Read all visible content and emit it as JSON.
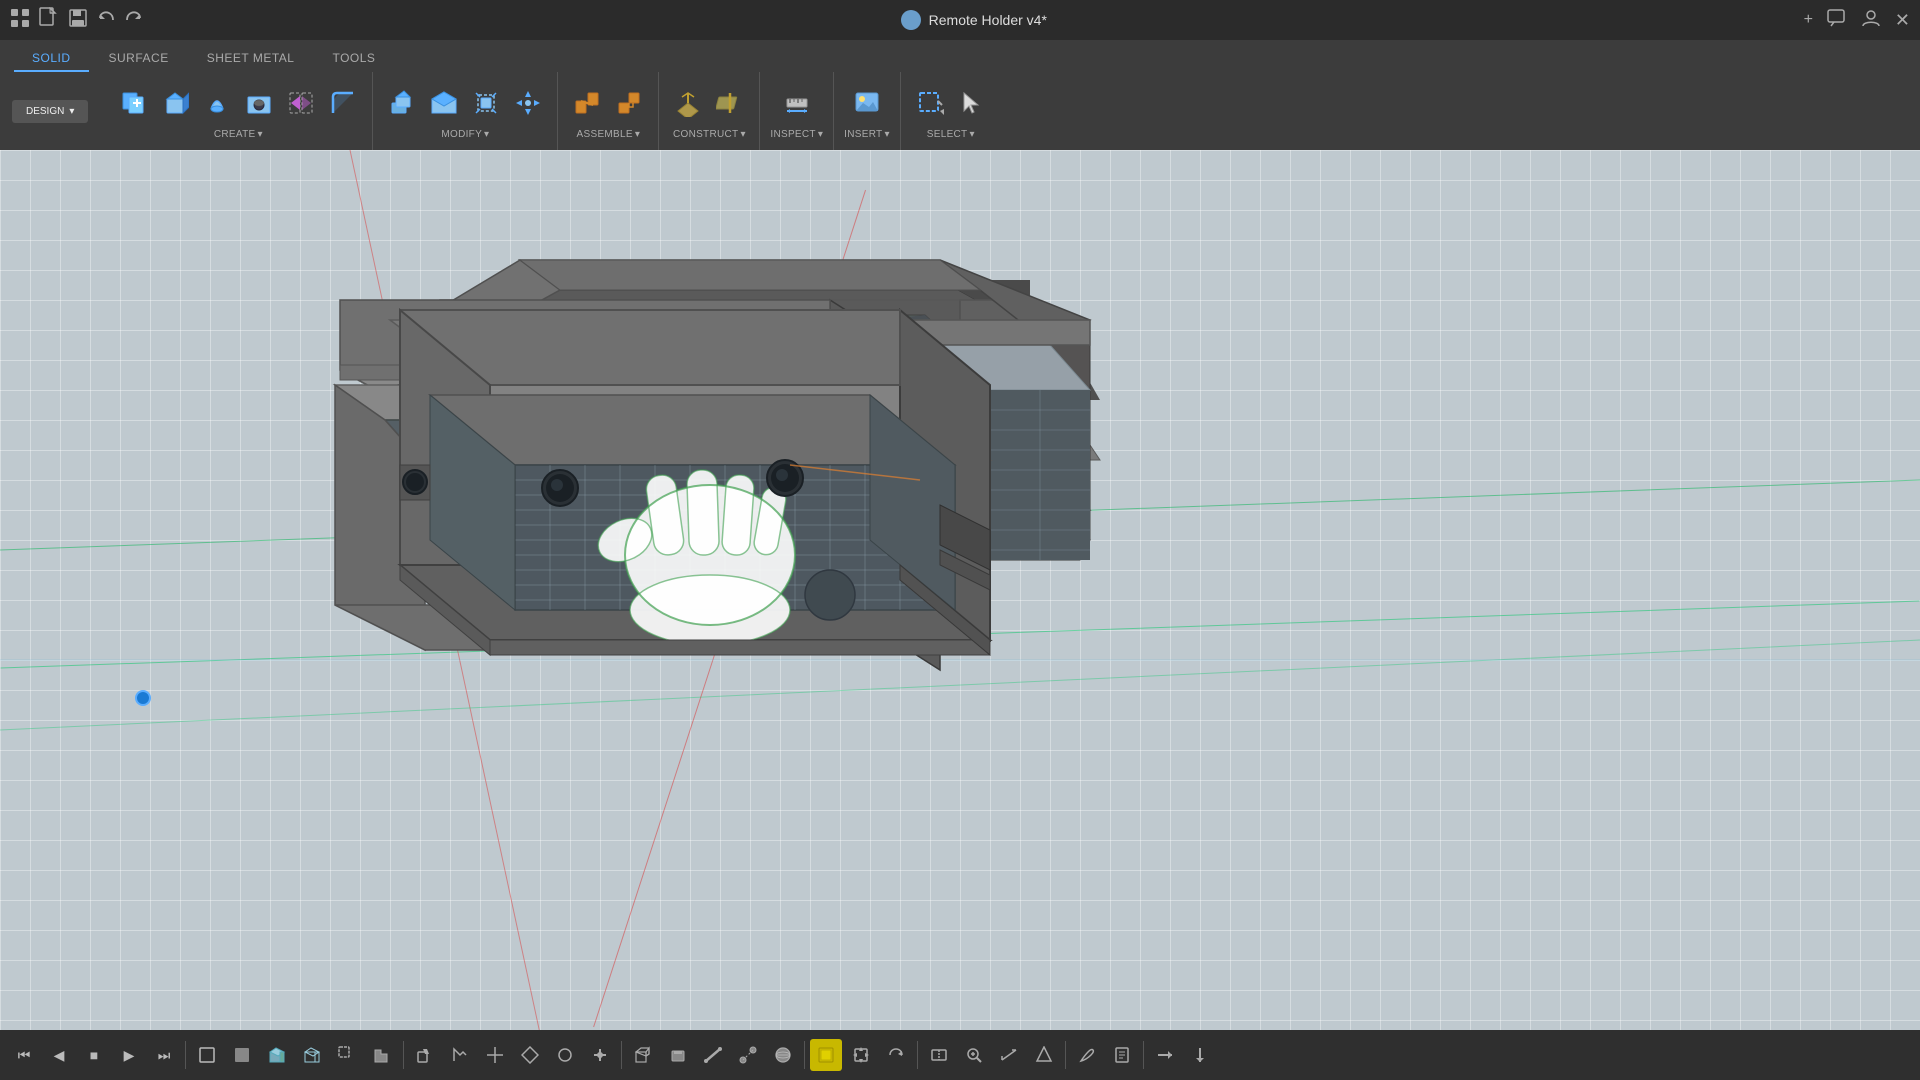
{
  "titleBar": {
    "appName": "Remote Holder v4*",
    "closeBtn": "✕",
    "addBtn": "+",
    "chatBtn": "💬",
    "userBtn": "👤"
  },
  "toolbar": {
    "designLabel": "DESIGN",
    "designArrow": "▾",
    "tabs": [
      {
        "id": "solid",
        "label": "SOLID",
        "active": true
      },
      {
        "id": "surface",
        "label": "SURFACE",
        "active": false
      },
      {
        "id": "sheet-metal",
        "label": "SHEET METAL",
        "active": false
      },
      {
        "id": "tools",
        "label": "TOOLS",
        "active": false
      }
    ],
    "groups": [
      {
        "id": "create",
        "label": "CREATE",
        "hasArrow": true
      },
      {
        "id": "modify",
        "label": "MODIFY",
        "hasArrow": true
      },
      {
        "id": "assemble",
        "label": "ASSEMBLE",
        "hasArrow": true
      },
      {
        "id": "construct",
        "label": "CONSTRUCT",
        "hasArrow": true
      },
      {
        "id": "inspect",
        "label": "INSPECT",
        "hasArrow": true
      },
      {
        "id": "insert",
        "label": "INSERT",
        "hasArrow": true
      },
      {
        "id": "select",
        "label": "SELECT",
        "hasArrow": true
      }
    ]
  },
  "canvas": {
    "bgColor": "#bfc9cf"
  },
  "statusBar": {
    "tools": [
      "⏮",
      "◀",
      "■",
      "▶",
      "⏭"
    ]
  }
}
